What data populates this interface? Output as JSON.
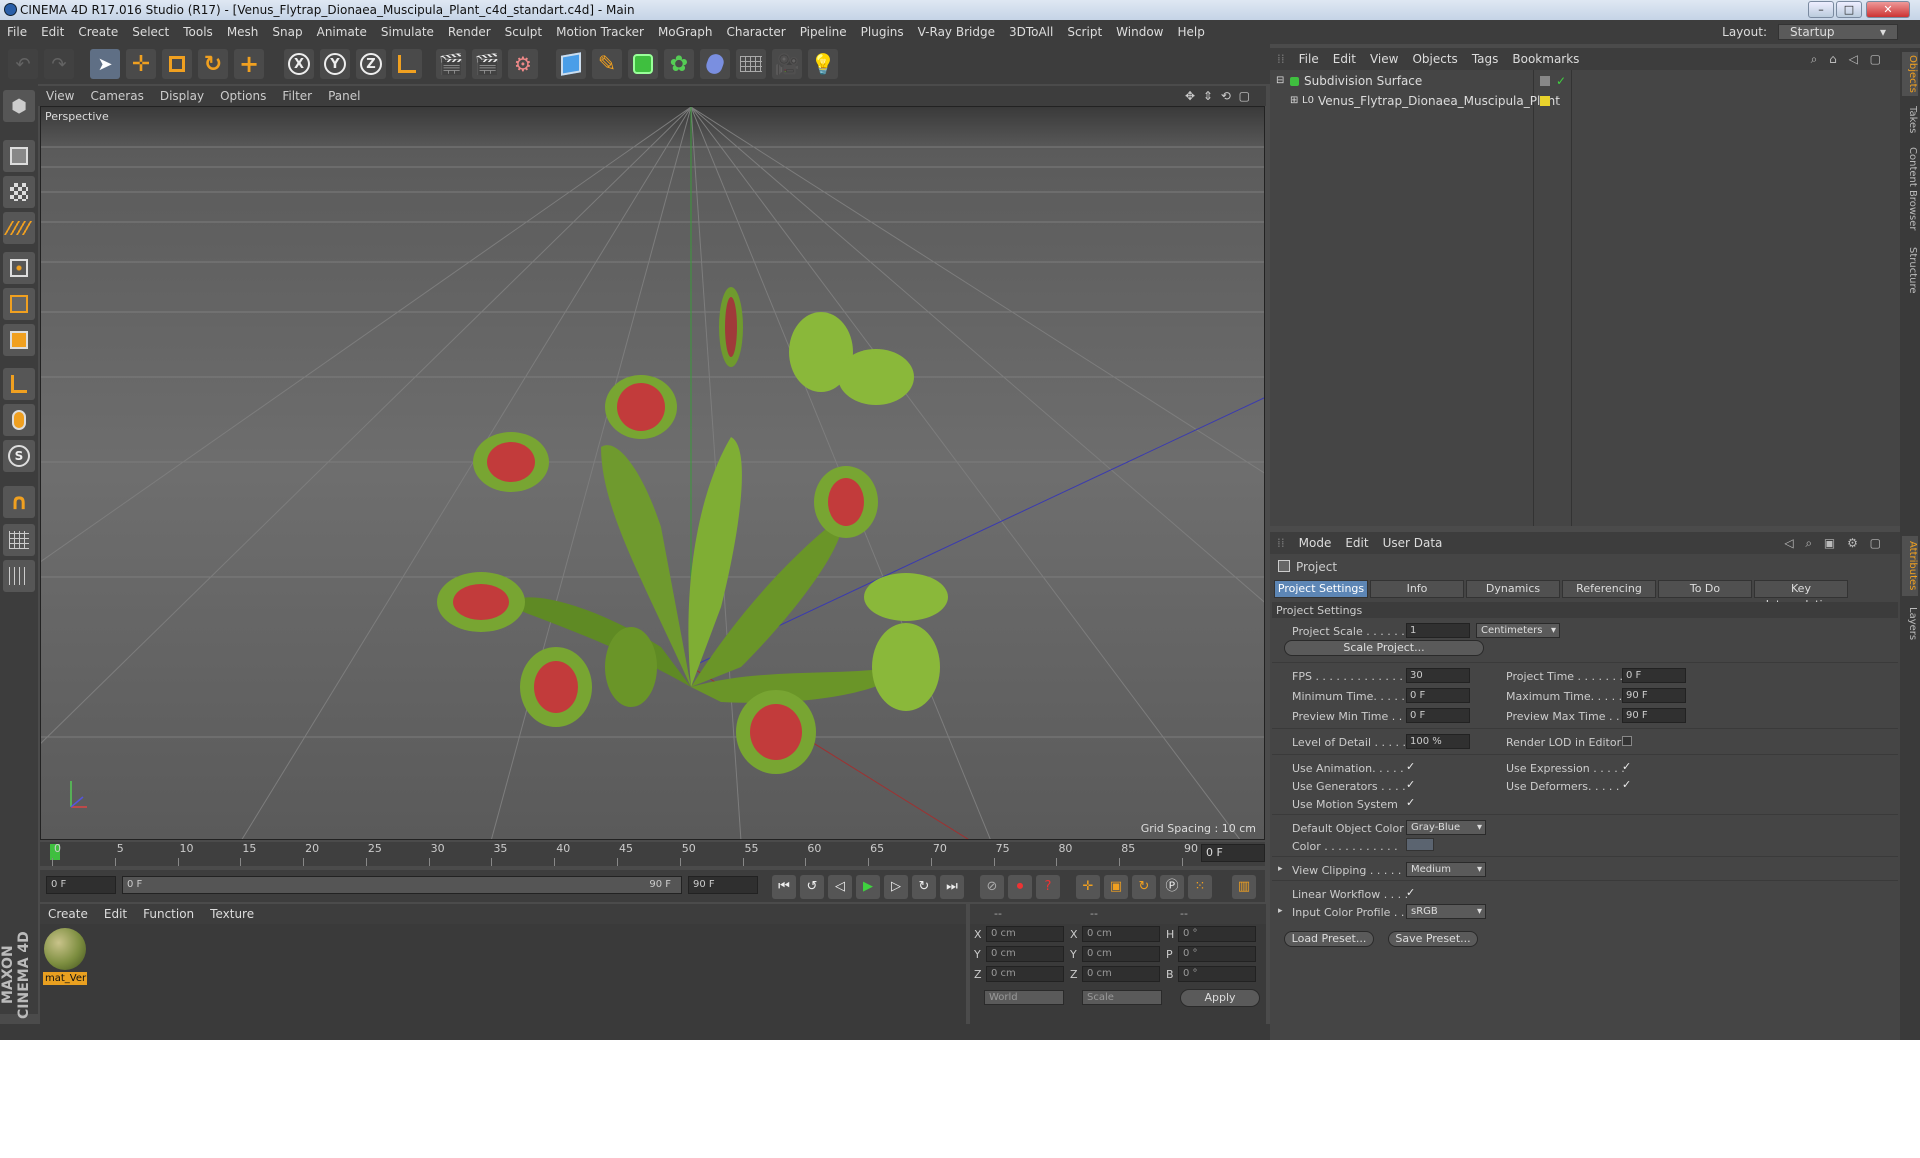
{
  "window": {
    "title": "CINEMA 4D R17.016 Studio (R17) - [Venus_Flytrap_Dionaea_Muscipula_Plant_c4d_standart.c4d] - Main"
  },
  "menubar": {
    "items": [
      "File",
      "Edit",
      "Create",
      "Select",
      "Tools",
      "Mesh",
      "Snap",
      "Animate",
      "Simulate",
      "Render",
      "Sculpt",
      "Motion Tracker",
      "MoGraph",
      "Character",
      "Pipeline",
      "Plugins",
      "V-Ray Bridge",
      "3DToAll",
      "Script",
      "Window",
      "Help"
    ],
    "layout_label": "Layout:",
    "layout_value": "Startup"
  },
  "toolbar": {
    "axis_x": "X",
    "axis_y": "Y",
    "axis_z": "Z"
  },
  "viewport": {
    "menu": [
      "View",
      "Cameras",
      "Display",
      "Options",
      "Filter",
      "Panel"
    ],
    "label": "Perspective",
    "grid_spacing": "Grid Spacing : 10 cm"
  },
  "timeline": {
    "ticks": [
      "0",
      "5",
      "10",
      "15",
      "20",
      "25",
      "30",
      "35",
      "40",
      "45",
      "50",
      "55",
      "60",
      "65",
      "70",
      "75",
      "80",
      "85",
      "90"
    ],
    "current_frame": "0 F",
    "start_field": "0 F",
    "range_start": "0 F",
    "range_end": "90 F",
    "end_field": "90 F"
  },
  "material_manager": {
    "menu": [
      "Create",
      "Edit",
      "Function",
      "Texture"
    ],
    "materials": [
      {
        "name": "mat_Ver"
      }
    ]
  },
  "coordinates": {
    "header": [
      "--",
      "--",
      "--"
    ],
    "rows": [
      {
        "a": "X",
        "av": "0 cm",
        "b": "X",
        "bv": "0 cm",
        "c": "H",
        "cv": "0 °"
      },
      {
        "a": "Y",
        "av": "0 cm",
        "b": "Y",
        "bv": "0 cm",
        "c": "P",
        "cv": "0 °"
      },
      {
        "a": "Z",
        "av": "0 cm",
        "b": "Z",
        "bv": "0 cm",
        "c": "B",
        "cv": "0 °"
      }
    ],
    "mode1": "World",
    "mode2": "Scale",
    "apply": "Apply"
  },
  "objects": {
    "menu": [
      "File",
      "Edit",
      "View",
      "Objects",
      "Tags",
      "Bookmarks"
    ],
    "items": [
      {
        "name": "Subdivision Surface",
        "color": "#3fbf3f"
      },
      {
        "name": "Venus_Flytrap_Dionaea_Muscipula_Plant",
        "color": "#e8d22c"
      }
    ]
  },
  "side_tabs": [
    "Objects",
    "Takes",
    "Content Browser",
    "Structure",
    "Attributes",
    "Layers"
  ],
  "attributes": {
    "menu": [
      "Mode",
      "Edit",
      "User Data"
    ],
    "header": "Project",
    "tabs": [
      "Project Settings",
      "Info",
      "Dynamics",
      "Referencing",
      "To Do",
      "Key Interpolation"
    ],
    "section": "Project Settings",
    "project_scale_label": "Project Scale . . . . . .",
    "project_scale_value": "1",
    "project_scale_unit": "Centimeters",
    "scale_project_btn": "Scale Project...",
    "fps_label": "FPS . . . . . . . . . . . . . .",
    "fps_value": "30",
    "project_time_label": "Project Time . . . . . . .",
    "project_time_value": "0 F",
    "min_time_label": "Minimum Time. . . . . .",
    "min_time_value": "0 F",
    "max_time_label": "Maximum Time. . . . . .",
    "max_time_value": "90 F",
    "prev_min_label": "Preview Min Time . . .",
    "prev_min_value": "0 F",
    "prev_max_label": "Preview Max Time . . .",
    "prev_max_value": "90 F",
    "lod_label": "Level of Detail . . . . .",
    "lod_value": "100 %",
    "render_lod_label": "Render LOD in Editor",
    "use_animation_label": "Use Animation. . . . .",
    "use_expression_label": "Use Expression . . . . .",
    "use_generators_label": "Use Generators . . . .",
    "use_deformers_label": "Use Deformers. . . . .",
    "use_motion_label": "Use Motion System",
    "default_color_label": "Default Object Color",
    "default_color_value": "Gray-Blue",
    "color_label": "Color . . . . . . . . . . .",
    "view_clipping_label": "View Clipping . . . . . .",
    "view_clipping_value": "Medium",
    "linear_workflow_label": "Linear Workflow . . . .",
    "input_color_label": "Input Color Profile . .",
    "input_color_value": "sRGB",
    "load_preset": "Load Preset...",
    "save_preset": "Save Preset...",
    "check": "✓"
  }
}
